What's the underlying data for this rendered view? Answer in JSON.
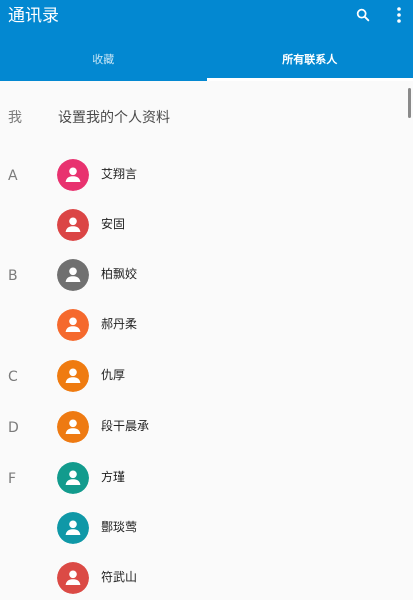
{
  "app": {
    "title": "通讯录",
    "accent": "#0388d1"
  },
  "toolbar": {
    "search_icon": "search-icon",
    "more_icon": "more-vert-icon"
  },
  "tabs": [
    {
      "label": "收藏",
      "active": false
    },
    {
      "label": "所有联系人",
      "active": true
    }
  ],
  "profile": {
    "letter": "我",
    "label": "设置我的个人资料"
  },
  "contacts": [
    {
      "letter": "A",
      "name": "艾翔言",
      "color": "#e8326f"
    },
    {
      "letter": "",
      "name": "安固",
      "color": "#db4545"
    },
    {
      "letter": "B",
      "name": "柏飘姣",
      "color": "#707070"
    },
    {
      "letter": "",
      "name": "郝丹柔",
      "color": "#f5692d"
    },
    {
      "letter": "C",
      "name": "仇厚",
      "color": "#ef7b10"
    },
    {
      "letter": "D",
      "name": "段干晨承",
      "color": "#ee7a12"
    },
    {
      "letter": "F",
      "name": "方瑾",
      "color": "#129b8d"
    },
    {
      "letter": "",
      "name": "酆琰莺",
      "color": "#0f98a7"
    },
    {
      "letter": "",
      "name": "符武山",
      "color": "#db4a45"
    }
  ]
}
